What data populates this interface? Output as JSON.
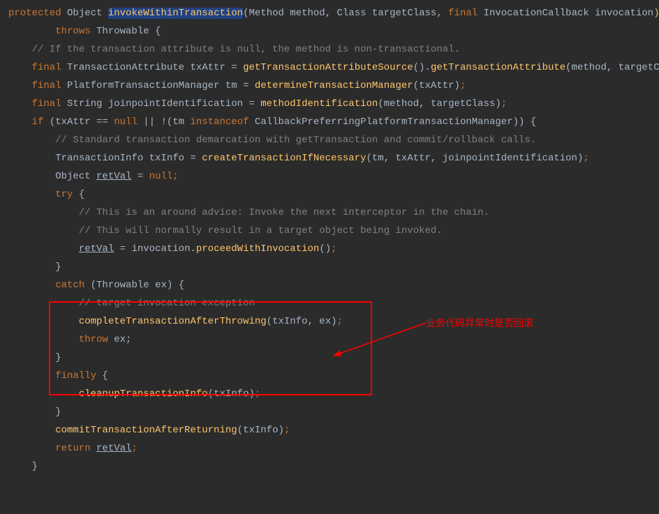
{
  "code": {
    "l1_protected": "protected",
    "l1_object": " Object ",
    "l1_method": "invokeWithinTransaction",
    "l1_p1": "(",
    "l1_params": "Method method, Class targetClass, ",
    "l1_final": "final",
    "l1_params2": " InvocationCallback invocation",
    "l1_p2": ")",
    "l2_throws": "        throws",
    "l2_throwable": " Throwable {",
    "l3": "",
    "l4_comment": "    // If the transaction attribute is null, the method is non-transactional.",
    "l5_final": "    final",
    "l5_type": " TransactionAttribute txAttr = ",
    "l5_call": "getTransactionAttributeSource",
    "l5_p1": "()",
    "l5_dot": ".",
    "l5_call2": "getTransactionAttribute",
    "l5_p2": "(",
    "l5_args": "method, targetClass",
    "l5_p3": ")",
    "l5_semi": ";",
    "l6_final": "    final",
    "l6_type": " PlatformTransactionManager tm = ",
    "l6_call": "determineTransactionManager",
    "l6_p1": "(",
    "l6_args": "txAttr",
    "l6_p2": ")",
    "l6_semi": ";",
    "l7_final": "    final",
    "l7_type": " String joinpointIdentification = ",
    "l7_call": "methodIdentification",
    "l7_p1": "(",
    "l7_args": "method, targetClass",
    "l7_p2": ")",
    "l7_semi": ";",
    "l8": "",
    "l9_if": "    if",
    "l9_p1": " (",
    "l9_cond1": "txAttr == ",
    "l9_null": "null",
    "l9_or": " || !",
    "l9_p2": "(",
    "l9_tm": "tm ",
    "l9_inst": "instanceof",
    "l9_cls": " CallbackPreferringPlatformTransactionManager",
    "l9_p3": "))",
    "l9_brace": " {",
    "l10_comment": "        // Standard transaction demarcation with getTransaction and commit/rollback calls.",
    "l11_type": "        TransactionInfo txInfo = ",
    "l11_call": "createTransactionIfNecessary",
    "l11_p1": "(",
    "l11_args": "tm, txAttr, joinpointIdentification",
    "l11_p2": ")",
    "l11_semi": ";",
    "l12_type": "        Object ",
    "l12_var": "retVal",
    "l12_eq": " = ",
    "l12_null": "null",
    "l12_semi": ";",
    "l13_try": "        try",
    "l13_brace": " {",
    "l14_comment": "            // This is an around advice: Invoke the next interceptor in the chain.",
    "l15_comment": "            // This will normally result in a target object being invoked.",
    "l16_pad": "            ",
    "l16_var": "retVal",
    "l16_eq": " = invocation.",
    "l16_call": "proceedWithInvocation",
    "l16_p": "()",
    "l16_semi": ";",
    "l17_brace": "        }",
    "l18_catch": "        catch",
    "l18_p1": " (",
    "l18_args": "Throwable ex",
    "l18_p2": ")",
    "l18_brace": " {",
    "l19_comment": "            // target invocation exception",
    "l20_pad": "            ",
    "l20_call": "completeTransactionAfterThrowing",
    "l20_p1": "(",
    "l20_args": "txInfo, ex",
    "l20_p2": ")",
    "l20_semi": ";",
    "l21_pad": "            ",
    "l21_throw": "throw",
    "l21_ex": " ex;",
    "l22_brace": "        }",
    "l23_finally": "        finally",
    "l23_brace": " {",
    "l24_pad": "            ",
    "l24_call": "cleanupTransactionInfo",
    "l24_p1": "(",
    "l24_args": "txInfo",
    "l24_p2": ")",
    "l24_semi": ";",
    "l25_brace": "        }",
    "l26_pad": "        ",
    "l26_call": "commitTransactionAfterReturning",
    "l26_p1": "(",
    "l26_args": "txInfo",
    "l26_p2": ")",
    "l26_semi": ";",
    "l27_return": "        return",
    "l27_pad": " ",
    "l27_var": "retVal",
    "l27_semi": ";",
    "l28_brace": "    }"
  },
  "annotation": "业务代码异常时是否回滚"
}
